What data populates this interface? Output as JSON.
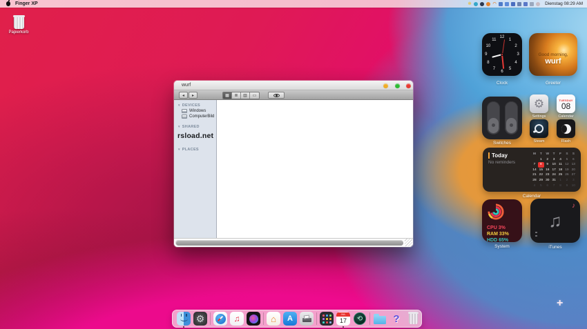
{
  "menu_bar": {
    "app_name": "Finger XP",
    "clock": "Dienstag 08:29 AM",
    "tray_icons": [
      {
        "name": "star-badge-icon",
        "shape": "glyph",
        "glyph": "✼",
        "color": "#e2c45e"
      },
      {
        "name": "globe-icon",
        "shape": "circle",
        "color": "#35a7c9"
      },
      {
        "name": "dark-orb-icon",
        "shape": "circle",
        "color": "#2b3850"
      },
      {
        "name": "orange-orb-icon",
        "shape": "circle",
        "color": "#e5832d"
      },
      {
        "name": "wifi-icon",
        "shape": "glyph",
        "glyph": "◠",
        "color": "#e5832d"
      },
      {
        "name": "flag-icon-1",
        "shape": "square",
        "color": "#4d7bc9"
      },
      {
        "name": "flag-icon-2",
        "shape": "square",
        "color": "#5d8bd9"
      },
      {
        "name": "flag-icon-3",
        "shape": "square",
        "color": "#4a6ec0"
      },
      {
        "name": "keyboard-icon",
        "shape": "square",
        "color": "#6a82b0"
      },
      {
        "name": "display-icon",
        "shape": "square",
        "color": "#5a78c8"
      },
      {
        "name": "battery-icon",
        "shape": "square",
        "color": "#9aa8be"
      },
      {
        "name": "dim-status-icon",
        "shape": "circle",
        "color": "#c8bcc4"
      }
    ]
  },
  "desktop": {
    "trash_label": "Papierkorb",
    "add_widget_glyph": "+"
  },
  "window": {
    "title": "wurf",
    "toolbar": {
      "back_glyph": "◂",
      "forward_glyph": "▸",
      "view_modes": [
        "icons",
        "list",
        "columns",
        "coverflow"
      ],
      "selected_view": "icons"
    },
    "sidebar": {
      "sections": [
        {
          "title": "DEVICES",
          "items": [
            {
              "label": "Windows",
              "icon": "disk"
            },
            {
              "label": "ComputerBild",
              "icon": "disk"
            }
          ]
        },
        {
          "title": "SHARED",
          "items": [
            {
              "label": "rsload.net",
              "icon": "none",
              "big": true
            }
          ]
        },
        {
          "title": "PLACES",
          "items": []
        }
      ]
    }
  },
  "widgets": {
    "clock": {
      "label": "Clock",
      "numbers": [
        "1",
        "2",
        "3",
        "4",
        "5",
        "6",
        "7",
        "8",
        "9",
        "10",
        "11",
        "12"
      ],
      "hour_angle": 255,
      "minute_angle": 174,
      "second_angle": 8
    },
    "greeter": {
      "label": "Greeter",
      "line1": "Good morning,",
      "line2": "wurf"
    },
    "switches": {
      "label": "Switches"
    },
    "settings_app": {
      "label": "Settings",
      "glyph": "⚙"
    },
    "mini_calendar": {
      "label": "Calendar",
      "weekday": "TUESDAY",
      "day": "08"
    },
    "steam": {
      "label": "Steam"
    },
    "flash": {
      "label": "Flash"
    },
    "calendar": {
      "label": "Calendar",
      "title": "Today",
      "subtitle": "No reminders",
      "day_headers": [
        "M",
        "T",
        "W",
        "T",
        "F",
        "S",
        "S"
      ],
      "weeks": [
        [
          "",
          "1",
          "2",
          "3",
          "4",
          "5",
          "6"
        ],
        [
          "7",
          "*8",
          "9",
          "10",
          "11",
          "12",
          "13"
        ],
        [
          "14",
          "15",
          "16",
          "17",
          "18",
          "19",
          "20"
        ],
        [
          "21",
          "22",
          "23",
          "24",
          "25",
          "26",
          "27"
        ],
        [
          "28",
          "29",
          "30",
          "31",
          ".1",
          ".2",
          ".3"
        ],
        [
          ".4",
          ".5",
          ".6",
          ".7",
          ".8",
          ".9",
          ".10"
        ]
      ],
      "selected_color": "#e8322e"
    },
    "system": {
      "label": "System",
      "cpu": "CPU 3%",
      "ram": "RAM 33%",
      "hdd": "HDD 65%",
      "cpu_color": "#f5465a",
      "ram_color": "#f5d040",
      "hdd_color": "#35c9c0"
    },
    "itunes": {
      "label": "iTunes"
    }
  },
  "dock": {
    "calendar_month": "JUL",
    "calendar_day": "17",
    "help_glyph": "?",
    "app_store_glyph": "A",
    "items": [
      {
        "name": "finder",
        "indicator": true
      },
      {
        "name": "preferences"
      },
      {
        "name": "divider"
      },
      {
        "name": "safari"
      },
      {
        "name": "music"
      },
      {
        "name": "siri"
      },
      {
        "name": "divider"
      },
      {
        "name": "home"
      },
      {
        "name": "app-store"
      },
      {
        "name": "printer"
      },
      {
        "name": "divider"
      },
      {
        "name": "launchpad"
      },
      {
        "name": "dock-calendar",
        "indicator": true
      },
      {
        "name": "time-machine"
      },
      {
        "name": "divider"
      },
      {
        "name": "downloads-folder"
      },
      {
        "name": "help"
      },
      {
        "name": "trash"
      }
    ]
  }
}
